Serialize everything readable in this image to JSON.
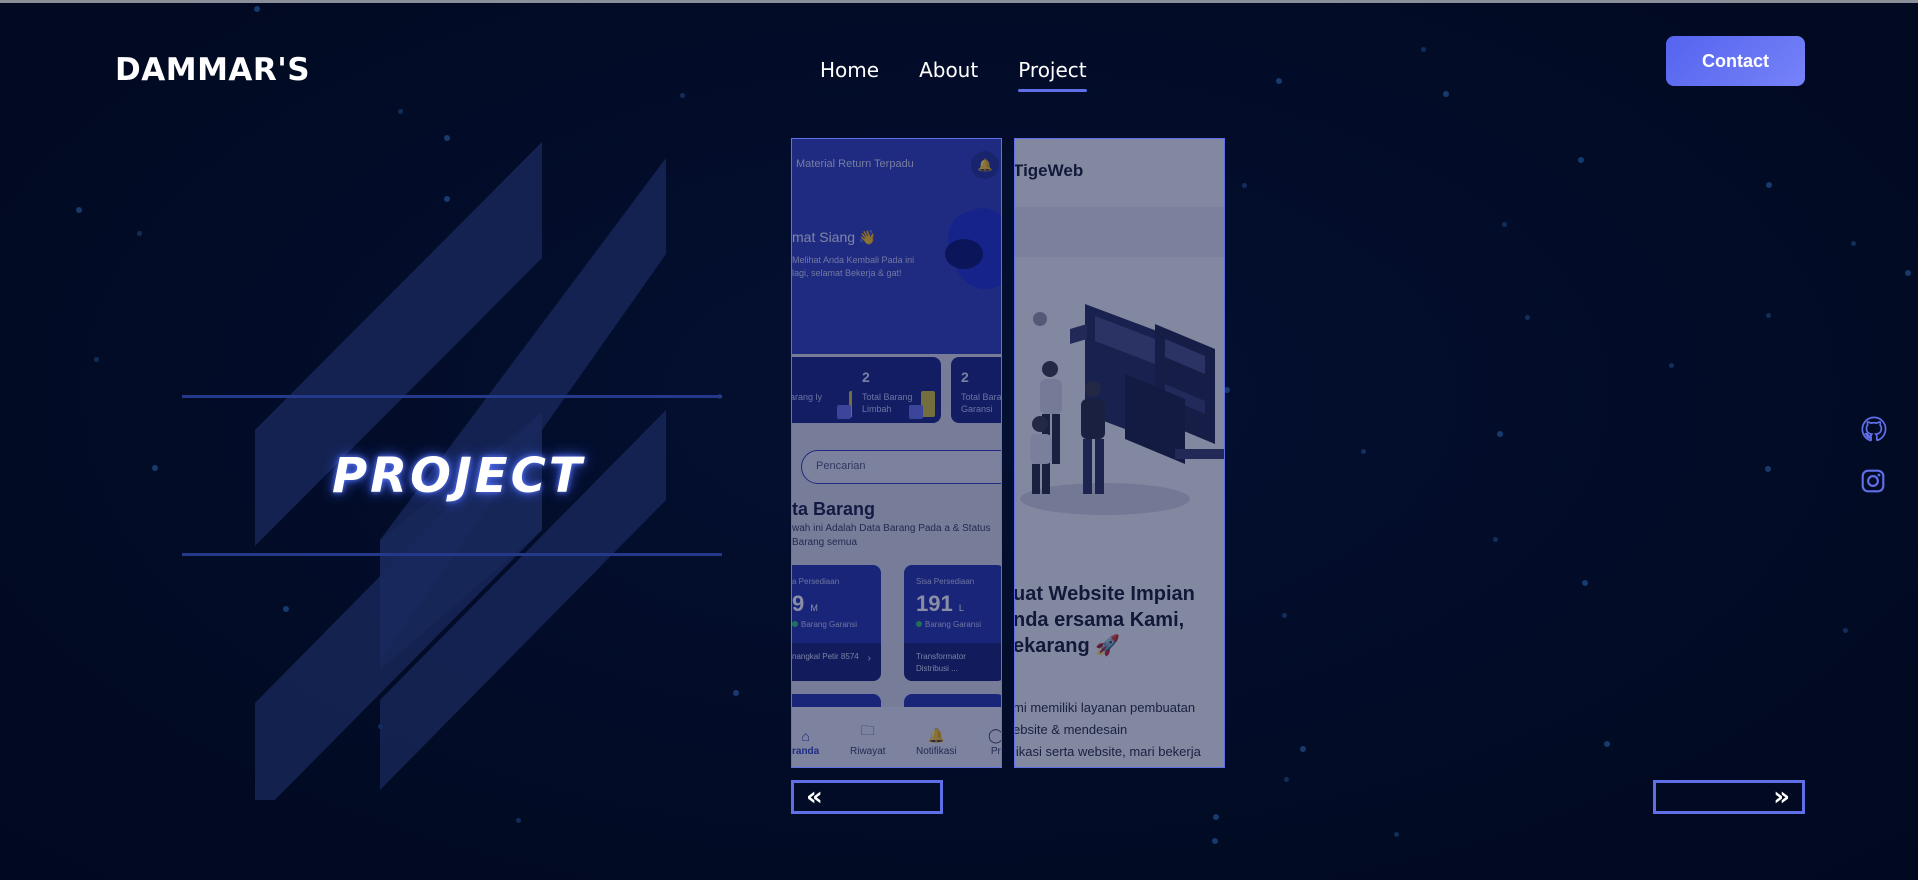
{
  "brand": {
    "name": "DAMMAR'S"
  },
  "nav": {
    "items": [
      {
        "label": "Home"
      },
      {
        "label": "About"
      },
      {
        "label": "Project"
      }
    ],
    "active": "Project"
  },
  "contact": {
    "label": "Contact"
  },
  "hero": {
    "title": "PROJECT"
  },
  "projects": [
    {
      "app_title": "Material Return Terpadu",
      "greeting": "mat Siang 👋",
      "greeting_sub": "Melihat Anda Kembali Pada ini lagi, selamat Bekerja & gat!",
      "stats": [
        {
          "num": "",
          "label": "arang ly"
        },
        {
          "num": "2",
          "label": "Total Barang Limbah"
        },
        {
          "num": "2",
          "label": "Total Baran Garansi"
        }
      ],
      "search_placeholder": "Pencarian",
      "data_title": "ta Barang",
      "data_sub": "wah ini Adalah Data Barang Pada a & Status Barang semua",
      "inventory": [
        {
          "label": "a Persediaan",
          "value": "9",
          "unit": "M",
          "tag": "Barang Garansi",
          "item": "nangkal Petir 8574"
        },
        {
          "label": "Sisa Persediaan",
          "value": "191",
          "unit": "L",
          "tag": "Barang Garansi",
          "item": "Transformator Distribusi ..."
        }
      ],
      "bottom_nav": [
        {
          "label": "randa"
        },
        {
          "label": "Riwayat"
        },
        {
          "label": "Notifikasi"
        },
        {
          "label": "Pr"
        }
      ]
    },
    {
      "site_title": "TigeWeb",
      "headline": "uat Website Impian nda ersama Kami, ekarang 🚀",
      "paragraph_lines": [
        "mi memiliki layanan pembuatan",
        "ebsite & mendesain",
        "likasi serta website, mari bekerja"
      ]
    }
  ],
  "social": [
    {
      "icon": "github-icon"
    },
    {
      "icon": "instagram-icon"
    }
  ],
  "colors": {
    "background": "#020c27",
    "accent": "#5f6fe8",
    "contact_button": "#5563ef"
  }
}
